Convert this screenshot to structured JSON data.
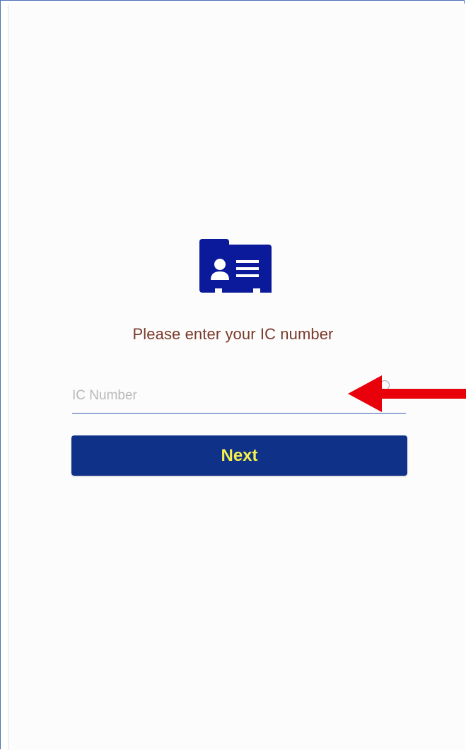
{
  "screen": {
    "prompt": "Please enter your IC number",
    "ic_input": {
      "placeholder": "IC Number",
      "value": ""
    },
    "next_button_label": "Next"
  },
  "icons": {
    "id_card": "id-card-icon",
    "field_status": "circle-icon",
    "annotation": "red-arrow-icon"
  },
  "colors": {
    "primary": "#0f3187",
    "icon": "#0a1a9a",
    "button_text": "#f5f04a",
    "prompt_text": "#7a3a2a",
    "annotation": "#e8000b"
  }
}
